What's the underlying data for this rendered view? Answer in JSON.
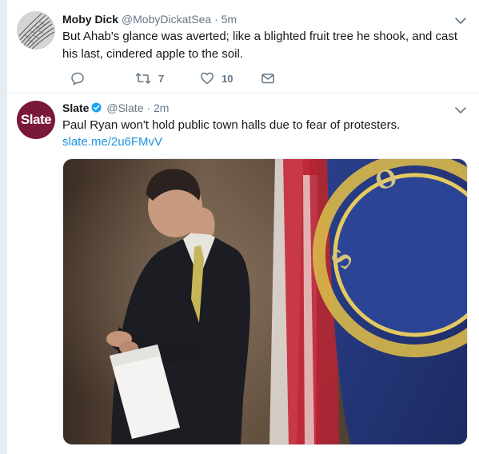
{
  "tweets": [
    {
      "name": "Moby Dick",
      "handle": "@MobyDickatSea",
      "separator": "·",
      "time": "5m",
      "text": "But Ahab's glance was averted; like a blighted fruit tree he shook, and cast his last, cindered apple to the soil.",
      "actions": {
        "reply_icon": "reply-icon",
        "retweet_icon": "retweet-icon",
        "retweet_count": "7",
        "like_icon": "heart-icon",
        "like_count": "10",
        "dm_icon": "envelope-icon"
      },
      "avatar": "sketch-avatar"
    },
    {
      "name": "Slate",
      "verified": true,
      "handle": "@Slate",
      "separator": "·",
      "time": "2m",
      "text": "Paul Ryan won't hold public town halls due to fear of protesters.",
      "link": "slate.me/2u6FMvV",
      "avatar_text": "Slate",
      "avatar_color": "#7a1839",
      "media": "photo-man-checking-watch-with-flag"
    }
  ],
  "colors": {
    "link": "#1b95e0",
    "muted": "#657786",
    "verified": "#1da1f2",
    "divider": "#e6ecf0"
  }
}
